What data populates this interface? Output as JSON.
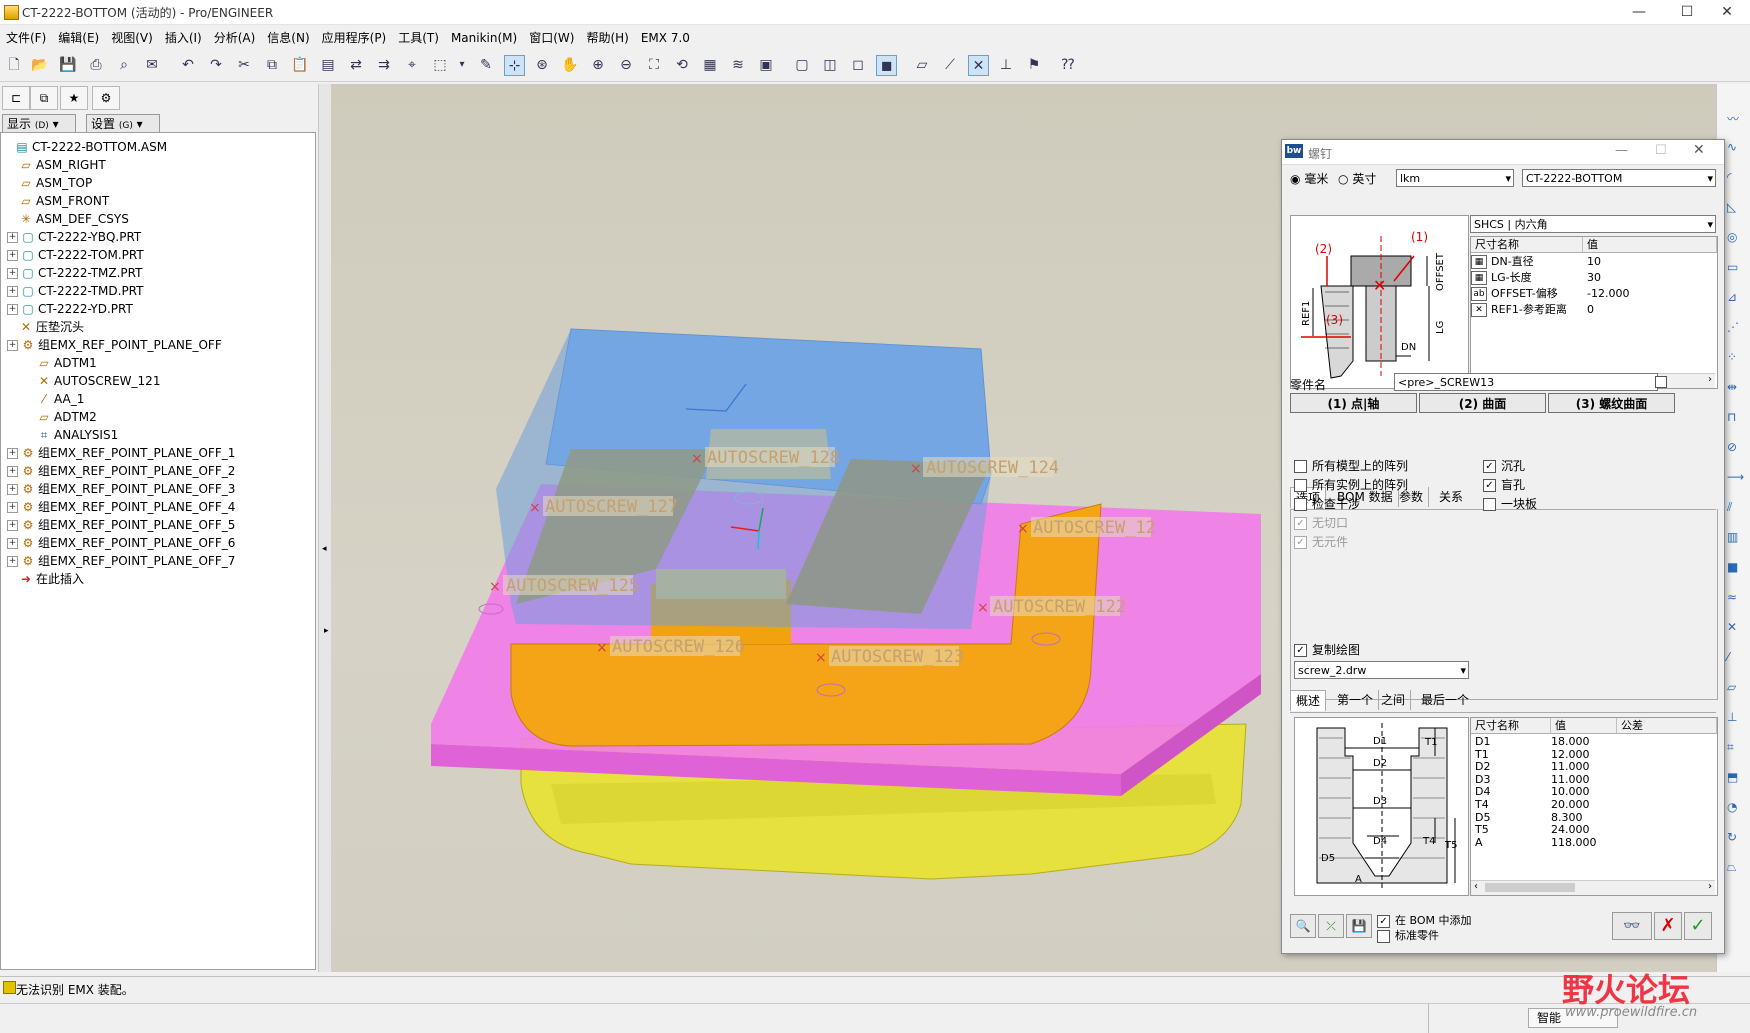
{
  "window": {
    "title": "CT-2222-BOTTOM (活动的) - Pro/ENGINEER",
    "minimize": "—",
    "maximize": "☐",
    "close": "✕"
  },
  "menu": [
    "文件(F)",
    "编辑(E)",
    "视图(V)",
    "插入(I)",
    "分析(A)",
    "信息(N)",
    "应用程序(P)",
    "工具(T)",
    "Manikin(M)",
    "窗口(W)",
    "帮助(H)",
    "EMX 7.0"
  ],
  "left_panel": {
    "show_label": "显示",
    "show_key": "(D)",
    "settings_label": "设置",
    "settings_key": "(G)",
    "tree": [
      {
        "label": "CT-2222-BOTTOM.ASM",
        "icon": "asm",
        "indent": 0,
        "exp": false
      },
      {
        "label": "ASM_RIGHT",
        "icon": "plane",
        "indent": 1,
        "exp": false
      },
      {
        "label": "ASM_TOP",
        "icon": "plane",
        "indent": 1,
        "exp": false
      },
      {
        "label": "ASM_FRONT",
        "icon": "plane",
        "indent": 1,
        "exp": false
      },
      {
        "label": "ASM_DEF_CSYS",
        "icon": "csys",
        "indent": 1,
        "exp": false
      },
      {
        "label": "CT-2222-YBQ.PRT",
        "icon": "part",
        "indent": 1,
        "exp": true
      },
      {
        "label": "CT-2222-TOM.PRT",
        "icon": "part",
        "indent": 1,
        "exp": true
      },
      {
        "label": "CT-2222-TMZ.PRT",
        "icon": "part",
        "indent": 1,
        "exp": true
      },
      {
        "label": "CT-2222-TMD.PRT",
        "icon": "part",
        "indent": 1,
        "exp": true
      },
      {
        "label": "CT-2222-YD.PRT",
        "icon": "part",
        "indent": 1,
        "exp": true
      },
      {
        "label": "压垫沉头",
        "icon": "point",
        "indent": 1,
        "exp": false
      },
      {
        "label": "组EMX_REF_POINT_PLANE_OFF",
        "icon": "group",
        "indent": 1,
        "exp": true
      },
      {
        "label": "ADTM1",
        "icon": "plane",
        "indent": 2,
        "exp": false
      },
      {
        "label": "AUTOSCREW_121",
        "icon": "point",
        "indent": 2,
        "exp": false
      },
      {
        "label": "AA_1",
        "icon": "axis",
        "indent": 2,
        "exp": false
      },
      {
        "label": "ADTM2",
        "icon": "plane",
        "indent": 2,
        "exp": false
      },
      {
        "label": "ANALYSIS1",
        "icon": "analysis",
        "indent": 2,
        "exp": false
      },
      {
        "label": "组EMX_REF_POINT_PLANE_OFF_1",
        "icon": "group",
        "indent": 1,
        "exp": true
      },
      {
        "label": "组EMX_REF_POINT_PLANE_OFF_2",
        "icon": "group",
        "indent": 1,
        "exp": true
      },
      {
        "label": "组EMX_REF_POINT_PLANE_OFF_3",
        "icon": "group",
        "indent": 1,
        "exp": true
      },
      {
        "label": "组EMX_REF_POINT_PLANE_OFF_4",
        "icon": "group",
        "indent": 1,
        "exp": true
      },
      {
        "label": "组EMX_REF_POINT_PLANE_OFF_5",
        "icon": "group",
        "indent": 1,
        "exp": true
      },
      {
        "label": "组EMX_REF_POINT_PLANE_OFF_6",
        "icon": "group",
        "indent": 1,
        "exp": true
      },
      {
        "label": "组EMX_REF_POINT_PLANE_OFF_7",
        "icon": "group",
        "indent": 1,
        "exp": true
      },
      {
        "label": "在此插入",
        "icon": "insert",
        "indent": 1,
        "exp": false
      }
    ]
  },
  "viewport": {
    "labels": [
      "AUTOSCREW_128",
      "AUTOSCREW_124",
      "AUTOSCREW_127",
      "AUTOSCREW_12",
      "AUTOSCREW_125",
      "AUTOSCREW_122",
      "AUTOSCREW_126",
      "AUTOSCREW_123"
    ]
  },
  "dialog": {
    "title": "螺钉",
    "logo": "bw",
    "unit_mm": "毫米",
    "unit_inch": "英寸",
    "catalog": "lkm",
    "assembly": "CT-2222-BOTTOM",
    "screw_type": "SHCS | 内六角",
    "param_headers": [
      "尺寸名称",
      "值"
    ],
    "params": [
      {
        "icon": "calc",
        "name": "DN-直径",
        "value": "10"
      },
      {
        "icon": "calc",
        "name": "LG-长度",
        "value": "30"
      },
      {
        "icon": "ab",
        "name": "OFFSET-偏移",
        "value": "-12.000"
      },
      {
        "icon": "x",
        "name": "REF1-参考距离",
        "value": "0"
      }
    ],
    "part_name_label": "零件名",
    "part_name_value": "<pre>_SCREW13",
    "btn_point": "(1) 点|轴",
    "btn_surface": "(2) 曲面",
    "btn_thread": "(3) 螺纹曲面",
    "tabs1": [
      "选项",
      "BOM 数据",
      "参数",
      "关系"
    ],
    "options_left": [
      {
        "label": "所有模型上的阵列",
        "checked": false,
        "disabled": false
      },
      {
        "label": "所有实例上的阵列",
        "checked": false,
        "disabled": false
      },
      {
        "label": "检查干涉",
        "checked": false,
        "disabled": false
      },
      {
        "label": "无切口",
        "checked": true,
        "disabled": true
      },
      {
        "label": "无元件",
        "checked": true,
        "disabled": true
      }
    ],
    "options_right": [
      {
        "label": "沉孔",
        "checked": true
      },
      {
        "label": "盲孔",
        "checked": true
      },
      {
        "label": "一块板",
        "checked": false
      }
    ],
    "copy_drawing_label": "复制绘图",
    "drawing_file": "screw_2.drw",
    "tabs2": [
      "概述",
      "第一个",
      "之间",
      "最后一个"
    ],
    "dim_headers": [
      "尺寸名称",
      "值",
      "公差"
    ],
    "dims": [
      {
        "name": "D1",
        "value": "18.000"
      },
      {
        "name": "T1",
        "value": "12.000"
      },
      {
        "name": "D2",
        "value": "11.000"
      },
      {
        "name": "D3",
        "value": "11.000"
      },
      {
        "name": "D4",
        "value": "10.000"
      },
      {
        "name": "T4",
        "value": "20.000"
      },
      {
        "name": "D5",
        "value": "8.300"
      },
      {
        "name": "T5",
        "value": "24.000"
      },
      {
        "name": "A",
        "value": "118.000"
      }
    ],
    "bom_add_label": "在 BOM 中添加",
    "std_part_label": "标准零件",
    "diagram_labels": {
      "ref1": "REF1",
      "offset": "OFFSET",
      "lg": "LG",
      "dn": "DN",
      "c1": "(1)",
      "c2": "(2)",
      "c3": "(3)"
    },
    "diagram2_labels": {
      "d1": "D1",
      "t1": "T1",
      "d2": "D2",
      "d3": "D3",
      "d4": "D4",
      "t4": "T4",
      "t5": "T5",
      "d5": "D5",
      "a": "A"
    }
  },
  "status": {
    "message": "无法识别 EMX 装配。",
    "mode": "智能"
  },
  "watermark": {
    "brand": "野火论坛",
    "url": "www.proewildfire.cn"
  }
}
